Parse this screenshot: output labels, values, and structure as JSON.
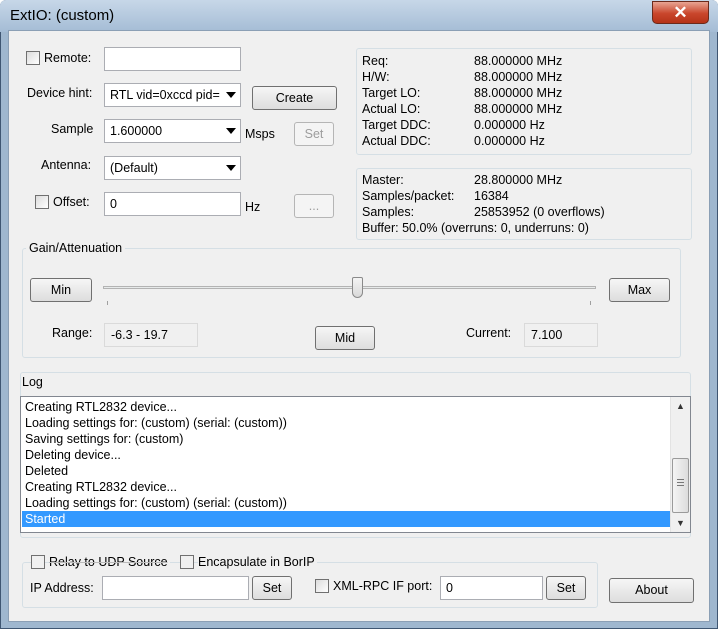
{
  "window": {
    "title": "ExtIO: (custom)",
    "close_glyph": "✕"
  },
  "remote": {
    "label": "Remote:",
    "value": ""
  },
  "device_hint": {
    "label": "Device hint:",
    "value": "RTL vid=0xccd pid=",
    "create": "Create"
  },
  "sample": {
    "label": "Sample",
    "value": "1.600000",
    "unit": "Msps",
    "set": "Set"
  },
  "antenna": {
    "label": "Antenna:",
    "value": "(Default)"
  },
  "offset": {
    "label": "Offset:",
    "value": "0",
    "unit": "Hz",
    "browse": "..."
  },
  "freq_info": [
    {
      "k": "Req:",
      "v": "88.000000 MHz"
    },
    {
      "k": "H/W:",
      "v": "88.000000 MHz"
    },
    {
      "k": "Target LO:",
      "v": "88.000000 MHz"
    },
    {
      "k": "Actual LO:",
      "v": "88.000000 MHz"
    },
    {
      "k": "Target DDC:",
      "v": "0.000000 Hz"
    },
    {
      "k": "Actual DDC:",
      "v": "0.000000 Hz"
    }
  ],
  "stream_info": {
    "master_k": "Master:",
    "master_v": "28.800000 MHz",
    "spp_k": "Samples/packet:",
    "spp_v": "16384",
    "samples_k": "Samples:",
    "samples_v": "25853952 (0 overflows)",
    "buffer": "Buffer: 50.0% (overruns: 0, underruns: 0)"
  },
  "gain": {
    "group_label": "Gain/Attenuation",
    "min": "Min",
    "max": "Max",
    "mid": "Mid",
    "range_label": "Range:",
    "range_value": "-6.3 - 19.7",
    "current_label": "Current:",
    "current_value": "7.100",
    "slider_fraction": 0.516
  },
  "log": {
    "label": "Log",
    "lines": [
      "Creating RTL2832 device...",
      "Loading settings for: (custom) (serial: (custom))",
      "Saving settings for: (custom)",
      "Deleting device...",
      "Deleted",
      "Creating RTL2832 device...",
      "Loading settings for: (custom) (serial: (custom))",
      "Started"
    ],
    "selected_index": 7,
    "scroll_up": "▲",
    "scroll_down": "▼"
  },
  "relay": {
    "relay_label": "Relay to UDP Source",
    "encapsulate_label": "Encapsulate in BorIP",
    "ip_label": "IP Address:",
    "ip_value": "",
    "ip_set": "Set",
    "xmlrpc_label": "XML-RPC IF port:",
    "xmlrpc_value": "0",
    "xmlrpc_set": "Set"
  },
  "about": "About"
}
